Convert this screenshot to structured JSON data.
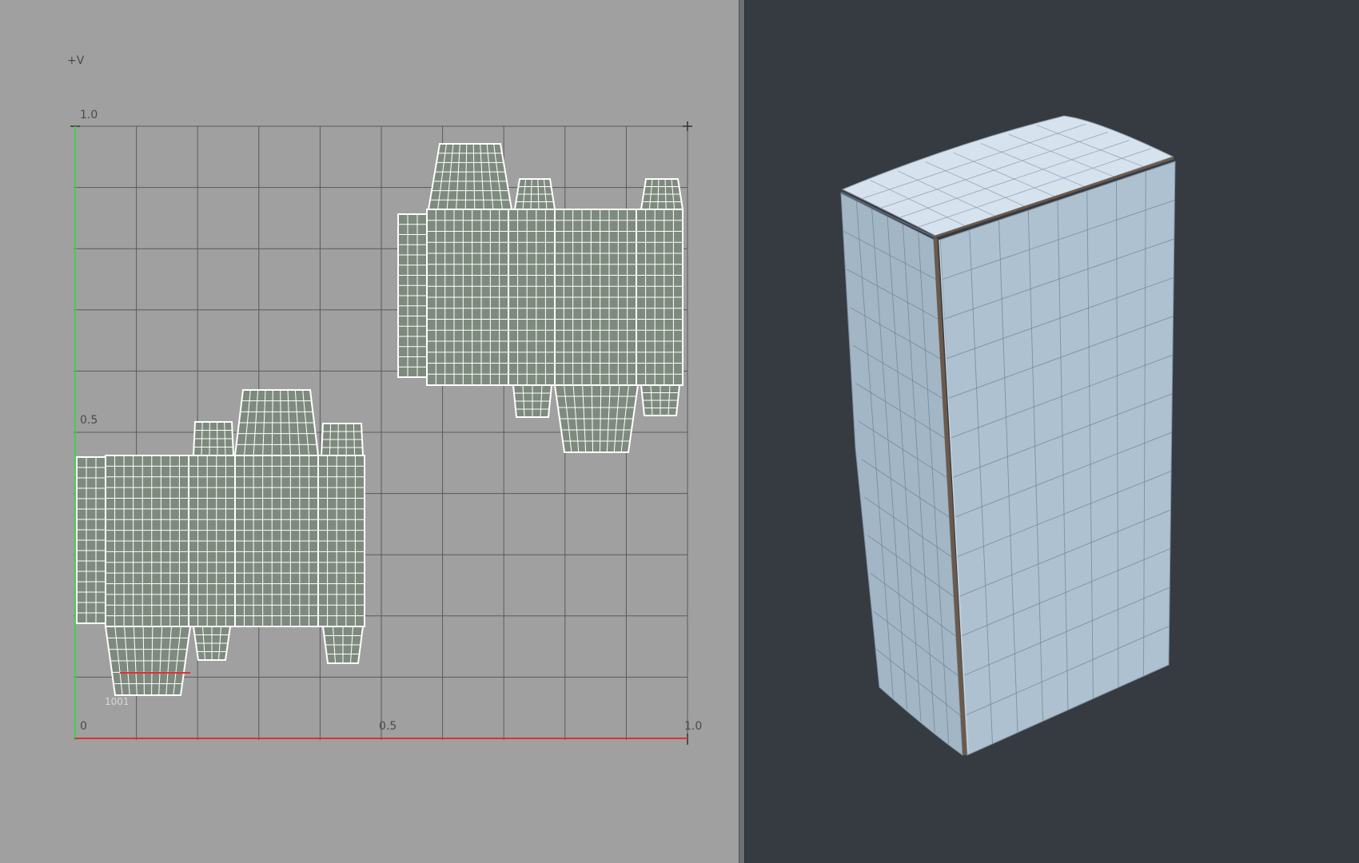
{
  "uv_editor": {
    "axis_label_v": "+V",
    "v_ticks": [
      "1.0",
      "0.5"
    ],
    "u_ticks": [
      "0",
      "0.5",
      "1.0"
    ],
    "tile_label": "1001",
    "colors": {
      "background": "#a0a0a0",
      "grid": "#5a5a5a",
      "v_axis": "#3fd24a",
      "u_axis": "#e03030",
      "shell_fill": "#7f8a7f",
      "wireframe": "#ffffff"
    }
  },
  "perspective_view": {
    "colors": {
      "background": "#353b41",
      "box_face": "#a9bccb",
      "box_side": "#9db0c0",
      "box_top": "#d6e2ee",
      "edge": "#6b5a4c"
    }
  }
}
